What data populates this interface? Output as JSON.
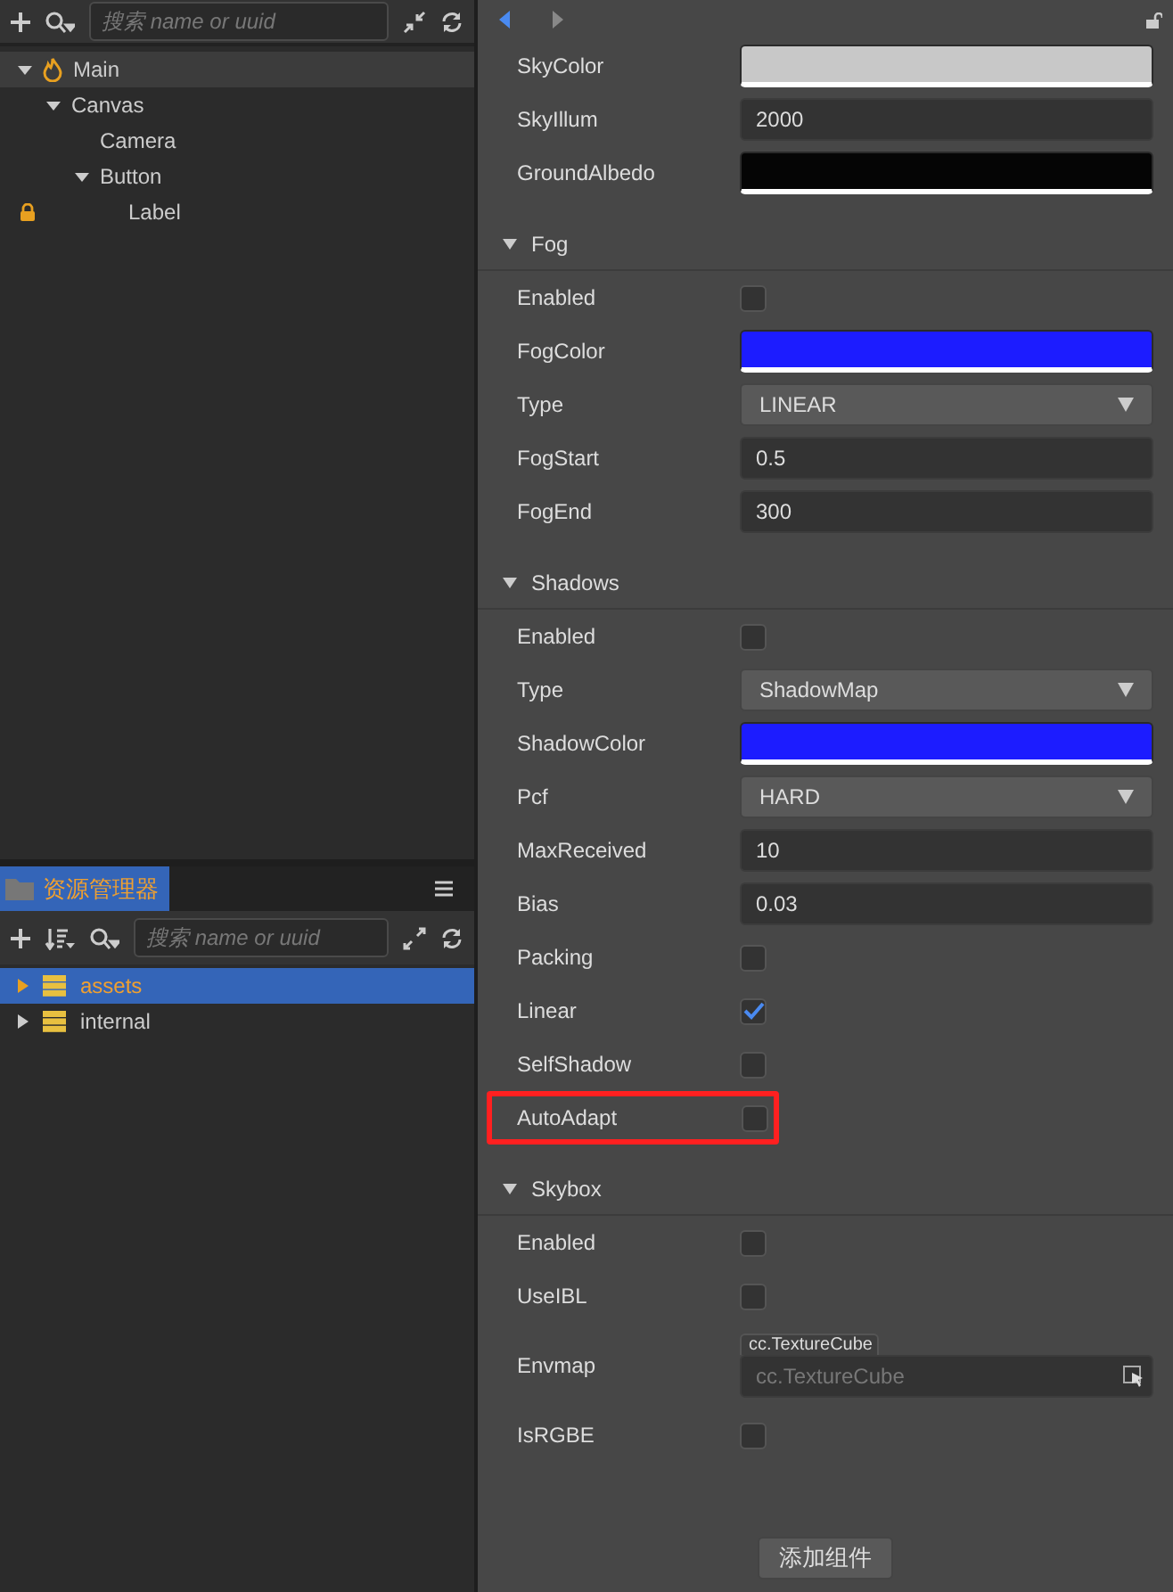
{
  "hierarchy": {
    "search": {
      "placeholder": "搜索 name or uuid"
    },
    "tree": [
      {
        "label": "Main",
        "kind": "scene",
        "selected": true,
        "expanded": true,
        "children": [
          {
            "label": "Canvas",
            "selected": false,
            "expanded": true,
            "children": [
              {
                "label": "Camera",
                "selected": false
              },
              {
                "label": "Button",
                "selected": false,
                "expanded": true,
                "children": [
                  {
                    "label": "Label",
                    "selected": false,
                    "locked": true
                  }
                ]
              }
            ]
          }
        ]
      }
    ]
  },
  "assets": {
    "title": "资源管理器",
    "search": {
      "placeholder": "搜索 name or uuid"
    },
    "items": [
      {
        "label": "assets",
        "selected": true
      },
      {
        "label": "internal",
        "selected": false
      }
    ]
  },
  "inspector": {
    "top_rows": [
      {
        "label": "SkyColor",
        "kind": "color",
        "color": "#c8c8c8"
      },
      {
        "label": "SkyIllum",
        "kind": "number",
        "value": "2000"
      },
      {
        "label": "GroundAlbedo",
        "kind": "color",
        "color": "#050505"
      }
    ],
    "sections": [
      {
        "title": "Fog",
        "expanded": true,
        "rows": [
          {
            "label": "Enabled",
            "kind": "checkbox",
            "checked": false
          },
          {
            "label": "FogColor",
            "kind": "color",
            "color": "#1c1cff"
          },
          {
            "label": "Type",
            "kind": "select",
            "value": "LINEAR"
          },
          {
            "label": "FogStart",
            "kind": "number",
            "value": "0.5"
          },
          {
            "label": "FogEnd",
            "kind": "number",
            "value": "300"
          }
        ]
      },
      {
        "title": "Shadows",
        "expanded": true,
        "rows": [
          {
            "label": "Enabled",
            "kind": "checkbox",
            "checked": false
          },
          {
            "label": "Type",
            "kind": "select",
            "value": "ShadowMap"
          },
          {
            "label": "ShadowColor",
            "kind": "color",
            "color": "#1c1cff"
          },
          {
            "label": "Pcf",
            "kind": "select",
            "value": "HARD"
          },
          {
            "label": "MaxReceived",
            "kind": "number",
            "value": "10"
          },
          {
            "label": "Bias",
            "kind": "number",
            "value": "0.03"
          },
          {
            "label": "Packing",
            "kind": "checkbox",
            "checked": false
          },
          {
            "label": "Linear",
            "kind": "checkbox",
            "checked": true
          },
          {
            "label": "SelfShadow",
            "kind": "checkbox",
            "checked": false
          },
          {
            "label": "AutoAdapt",
            "kind": "checkbox",
            "checked": false,
            "highlighted": true
          }
        ]
      },
      {
        "title": "Skybox",
        "expanded": true,
        "rows": [
          {
            "label": "Enabled",
            "kind": "checkbox",
            "checked": false
          },
          {
            "label": "UseIBL",
            "kind": "checkbox",
            "checked": false
          },
          {
            "label": "Envmap",
            "kind": "asset",
            "type_tag": "cc.TextureCube",
            "placeholder": "cc.TextureCube"
          },
          {
            "label": "IsRGBE",
            "kind": "checkbox",
            "checked": false
          }
        ]
      }
    ],
    "add_button": "添加组件"
  }
}
